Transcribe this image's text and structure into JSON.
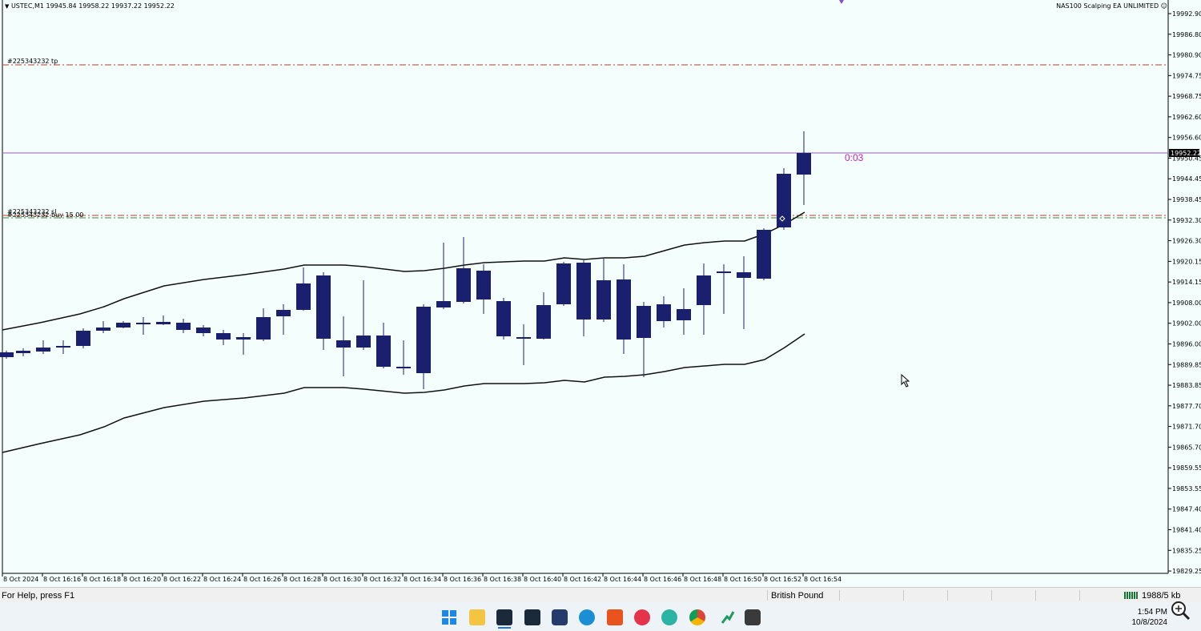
{
  "chart": {
    "symbol_header": "USTEC,M1  19945.84 19958.22 19937.22 19952.22",
    "ea_name": "NAS100 Scalping EA UNLIMITED",
    "countdown": "0:03",
    "current_price_label": "19952.22",
    "tp_label": "#225343232 tp",
    "sl_label": "#225343232 sl",
    "buy_label": "#225343232 buy 15.00",
    "colors": {
      "background": "#f4fffd",
      "candle": "#1a1f6e",
      "tp_line": "#c0392b",
      "sl_line": "#c0392b",
      "entry_line": "#2e8b2e",
      "price_line": "#9b59b6",
      "countdown": "#d11ac4",
      "bands": "#111111"
    }
  },
  "price_axis": [
    "19992.90",
    "19986.80",
    "19980.90",
    "19974.75",
    "19968.75",
    "19962.60",
    "19956.60",
    "19950.45",
    "19944.45",
    "19938.45",
    "19932.30",
    "19926.30",
    "19920.15",
    "19914.15",
    "19908.00",
    "19902.00",
    "19896.00",
    "19889.85",
    "19883.85",
    "19877.70",
    "19871.70",
    "19865.70",
    "19859.55",
    "19853.55",
    "19847.40",
    "19841.40",
    "19835.25",
    "19829.25"
  ],
  "time_axis": [
    "8 Oct 2024",
    "8 Oct 16:16",
    "8 Oct 16:18",
    "8 Oct 16:20",
    "8 Oct 16:22",
    "8 Oct 16:24",
    "8 Oct 16:26",
    "8 Oct 16:28",
    "8 Oct 16:30",
    "8 Oct 16:32",
    "8 Oct 16:34",
    "8 Oct 16:36",
    "8 Oct 16:38",
    "8 Oct 16:40",
    "8 Oct 16:42",
    "8 Oct 16:44",
    "8 Oct 16:46",
    "8 Oct 16:48",
    "8 Oct 16:50",
    "8 Oct 16:52",
    "8 Oct 16:54"
  ],
  "status": {
    "help": "For Help, press F1",
    "currency": "British Pound",
    "traffic": "1988/5 kb"
  },
  "taskbar": {
    "time": "1:54 PM",
    "date": "10/8/2024",
    "apps": [
      "windows-start-icon",
      "file-explorer-icon",
      "metatrader-icon",
      "metatrader-2-icon",
      "app-icon",
      "edge-icon",
      "ninjatrader-icon",
      "music-app-icon",
      "edge-beta-icon",
      "chrome-icon",
      "chart-app-icon",
      "record-app-icon"
    ]
  }
}
